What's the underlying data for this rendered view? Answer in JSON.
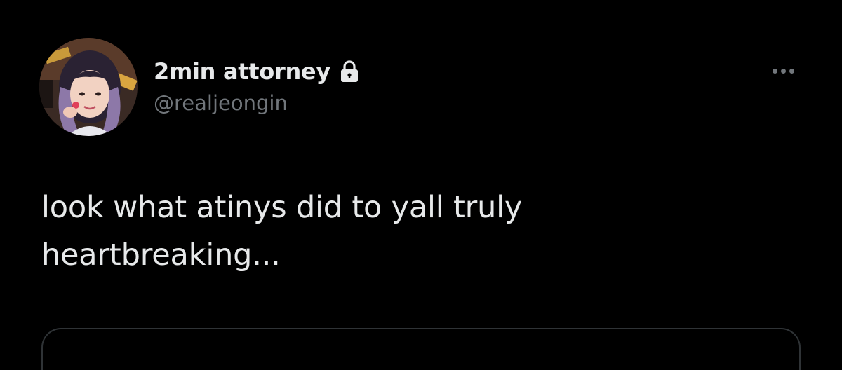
{
  "theme": {
    "background": "#000000",
    "text_primary": "#e7e9ea",
    "text_secondary": "#71767b",
    "border": "#2f3336"
  },
  "author": {
    "display_name": "2min attorney",
    "handle": "@realjeongin",
    "protected_icon": "lock-icon",
    "avatar_icon": "profile-photo"
  },
  "menu": {
    "icon": "more-options-icon"
  },
  "tweet": {
    "text_lines": [
      "look what atinys did to yall truly",
      "heartbreaking..."
    ]
  }
}
